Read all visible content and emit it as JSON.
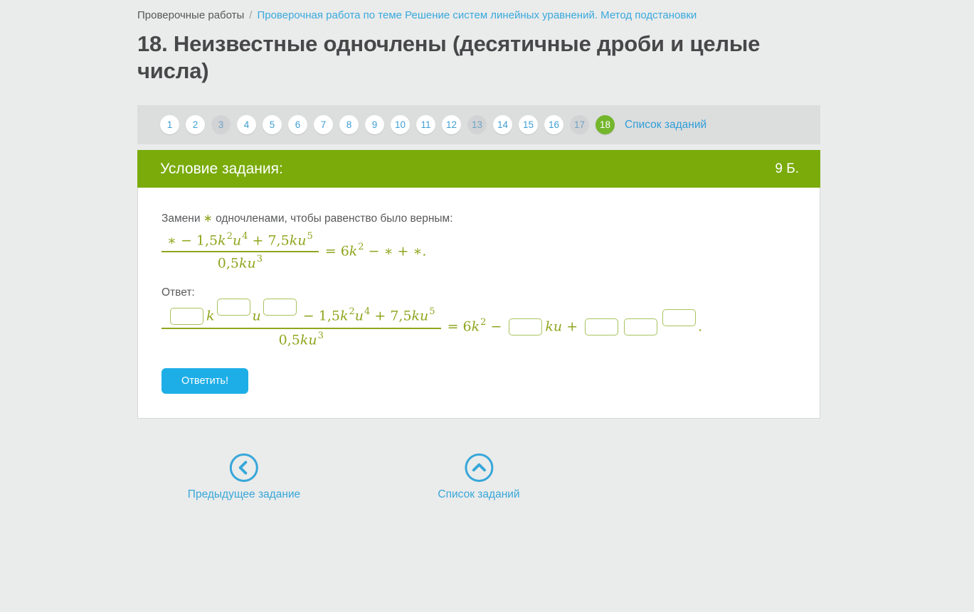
{
  "colors": {
    "page_bg": "#eaebeb",
    "pagination_bar_bg": "#dcdddd",
    "header_green": "#7aab0a",
    "active_circle_green": "#74b62c",
    "formula_green": "#8fa51d",
    "input_border_green": "#a9c25d",
    "link_blue": "#39a9dc",
    "button_blue": "#1daee7",
    "text_gray": "#58595b"
  },
  "breadcrumb": {
    "root": "Проверочные работы",
    "separator": "/",
    "current": "Проверочная работа по теме Решение систем линейных уравнений. Метод подстановки"
  },
  "page_title": "18. Неизвестные одночлены (десятичные дроби и целые числа)",
  "pagination": {
    "items": [
      {
        "label": "1",
        "state": "default"
      },
      {
        "label": "2",
        "state": "default"
      },
      {
        "label": "3",
        "state": "visited"
      },
      {
        "label": "4",
        "state": "default"
      },
      {
        "label": "5",
        "state": "default"
      },
      {
        "label": "6",
        "state": "default"
      },
      {
        "label": "7",
        "state": "default"
      },
      {
        "label": "8",
        "state": "default"
      },
      {
        "label": "9",
        "state": "default"
      },
      {
        "label": "10",
        "state": "default"
      },
      {
        "label": "11",
        "state": "default"
      },
      {
        "label": "12",
        "state": "default"
      },
      {
        "label": "13",
        "state": "visited"
      },
      {
        "label": "14",
        "state": "default"
      },
      {
        "label": "15",
        "state": "default"
      },
      {
        "label": "16",
        "state": "default"
      },
      {
        "label": "17",
        "state": "visited"
      },
      {
        "label": "18",
        "state": "active"
      }
    ],
    "list_link": "Список заданий"
  },
  "condition": {
    "header": "Условие задания:",
    "points": "9 Б.",
    "instruction": [
      {
        "type": "text",
        "text": "Замени "
      },
      {
        "type": "star",
        "text": "∗"
      },
      {
        "type": "text",
        "text": " одночленами, чтобы равенство было верным:"
      }
    ],
    "formula": {
      "numerator": [
        {
          "type": "mo",
          "text": "∗ − "
        },
        {
          "type": "mn",
          "text": "1,5"
        },
        {
          "type": "mi",
          "text": "k"
        },
        {
          "type": "sup",
          "text": "2"
        },
        {
          "type": "mi",
          "text": "u"
        },
        {
          "type": "sup",
          "text": "4"
        },
        {
          "type": "mo",
          "text": " + "
        },
        {
          "type": "mn",
          "text": "7,5"
        },
        {
          "type": "mi",
          "text": "ku"
        },
        {
          "type": "sup",
          "text": "5"
        }
      ],
      "denominator": [
        {
          "type": "mn",
          "text": "0,5"
        },
        {
          "type": "mi",
          "text": "ku"
        },
        {
          "type": "sup",
          "text": "3"
        }
      ],
      "rhs": [
        {
          "type": "mo",
          "text": "= "
        },
        {
          "type": "mn",
          "text": "6"
        },
        {
          "type": "mi",
          "text": "k"
        },
        {
          "type": "sup",
          "text": "2"
        },
        {
          "type": "mo",
          "text": " − ∗ + ∗."
        }
      ]
    }
  },
  "answer": {
    "label": "Ответ:",
    "formula": {
      "numerator": [
        {
          "type": "input",
          "name": "answer-input-coefficient-1",
          "value": ""
        },
        {
          "type": "mi",
          "text": "k"
        },
        {
          "type": "input-sup",
          "name": "answer-input-exponent-k",
          "value": ""
        },
        {
          "type": "mi",
          "text": "u"
        },
        {
          "type": "input-sup",
          "name": "answer-input-exponent-u",
          "value": ""
        },
        {
          "type": "mo",
          "text": " − "
        },
        {
          "type": "mn",
          "text": "1,5"
        },
        {
          "type": "mi",
          "text": "k"
        },
        {
          "type": "sup",
          "text": "2"
        },
        {
          "type": "mi",
          "text": "u"
        },
        {
          "type": "sup",
          "text": "4"
        },
        {
          "type": "mo",
          "text": " + "
        },
        {
          "type": "mn",
          "text": "7,5"
        },
        {
          "type": "mi",
          "text": "ku"
        },
        {
          "type": "sup",
          "text": "5"
        }
      ],
      "denominator": [
        {
          "type": "mn",
          "text": "0,5"
        },
        {
          "type": "mi",
          "text": "ku"
        },
        {
          "type": "sup",
          "text": "3"
        }
      ],
      "rhs": [
        {
          "type": "mo",
          "text": "= "
        },
        {
          "type": "mn",
          "text": "6"
        },
        {
          "type": "mi",
          "text": "k"
        },
        {
          "type": "sup",
          "text": "2"
        },
        {
          "type": "mo",
          "text": " − "
        },
        {
          "type": "input",
          "name": "answer-input-coefficient-2",
          "value": ""
        },
        {
          "type": "mi",
          "text": "ku"
        },
        {
          "type": "mo",
          "text": " + "
        },
        {
          "type": "input",
          "name": "answer-input-coefficient-3",
          "value": ""
        },
        {
          "type": "input",
          "name": "answer-input-base-4",
          "value": ""
        },
        {
          "type": "input-sup",
          "name": "answer-input-exponent-4",
          "value": ""
        },
        {
          "type": "mo",
          "text": "."
        }
      ]
    }
  },
  "submit": {
    "label": "Ответить!"
  },
  "footer_nav": {
    "prev_label": "Предыдущее задание",
    "list_label": "Список заданий"
  }
}
